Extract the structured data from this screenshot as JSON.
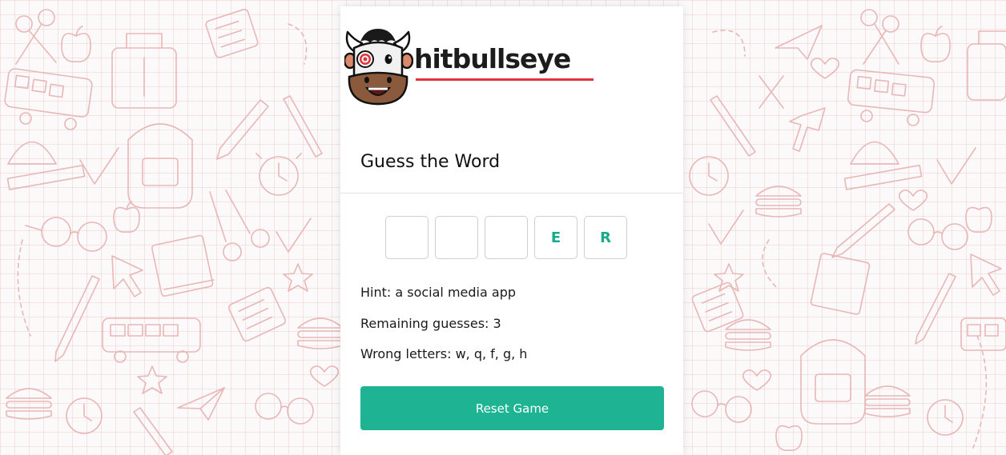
{
  "brand": {
    "name": "hitbullseye",
    "mascot_icon": "bull-mascot-icon",
    "accent_underline_color": "#e0343c"
  },
  "game": {
    "title": "Guess the Word",
    "letters": [
      "",
      "",
      "",
      "E",
      "R"
    ],
    "hint_label": "Hint: a social media app",
    "remaining_label": "Remaining guesses: 3",
    "wrong_label": "Wrong letters: w, q, f, g, h",
    "reset_label": "Reset Game"
  },
  "theme": {
    "button_color": "#1db393",
    "letter_color": "#1aa98d",
    "background_doodle_color": "#e8b5b5"
  }
}
